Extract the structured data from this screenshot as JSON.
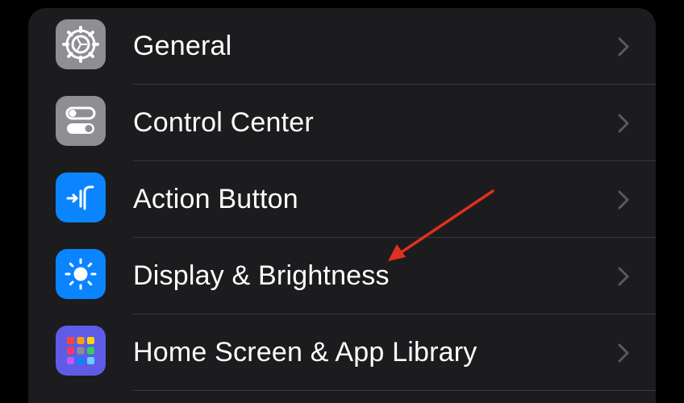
{
  "settings": {
    "items": [
      {
        "label": "General",
        "icon": "gear-icon",
        "icon_bg": "#8e8e93"
      },
      {
        "label": "Control Center",
        "icon": "toggles-icon",
        "icon_bg": "#8e8e93"
      },
      {
        "label": "Action Button",
        "icon": "action-button-icon",
        "icon_bg": "#0a84ff"
      },
      {
        "label": "Display & Brightness",
        "icon": "sun-icon",
        "icon_bg": "#0a84ff"
      },
      {
        "label": "Home Screen & App Library",
        "icon": "app-grid-icon",
        "icon_bg": "#5e5ce6"
      }
    ]
  },
  "annotation": {
    "arrow_color": "#e0301e",
    "points_to": "Display & Brightness"
  },
  "colors": {
    "background": "#000000",
    "group_bg": "#1c1c1e",
    "separator": "#38383a",
    "text": "#ffffff",
    "chevron": "#5a5a5e"
  }
}
